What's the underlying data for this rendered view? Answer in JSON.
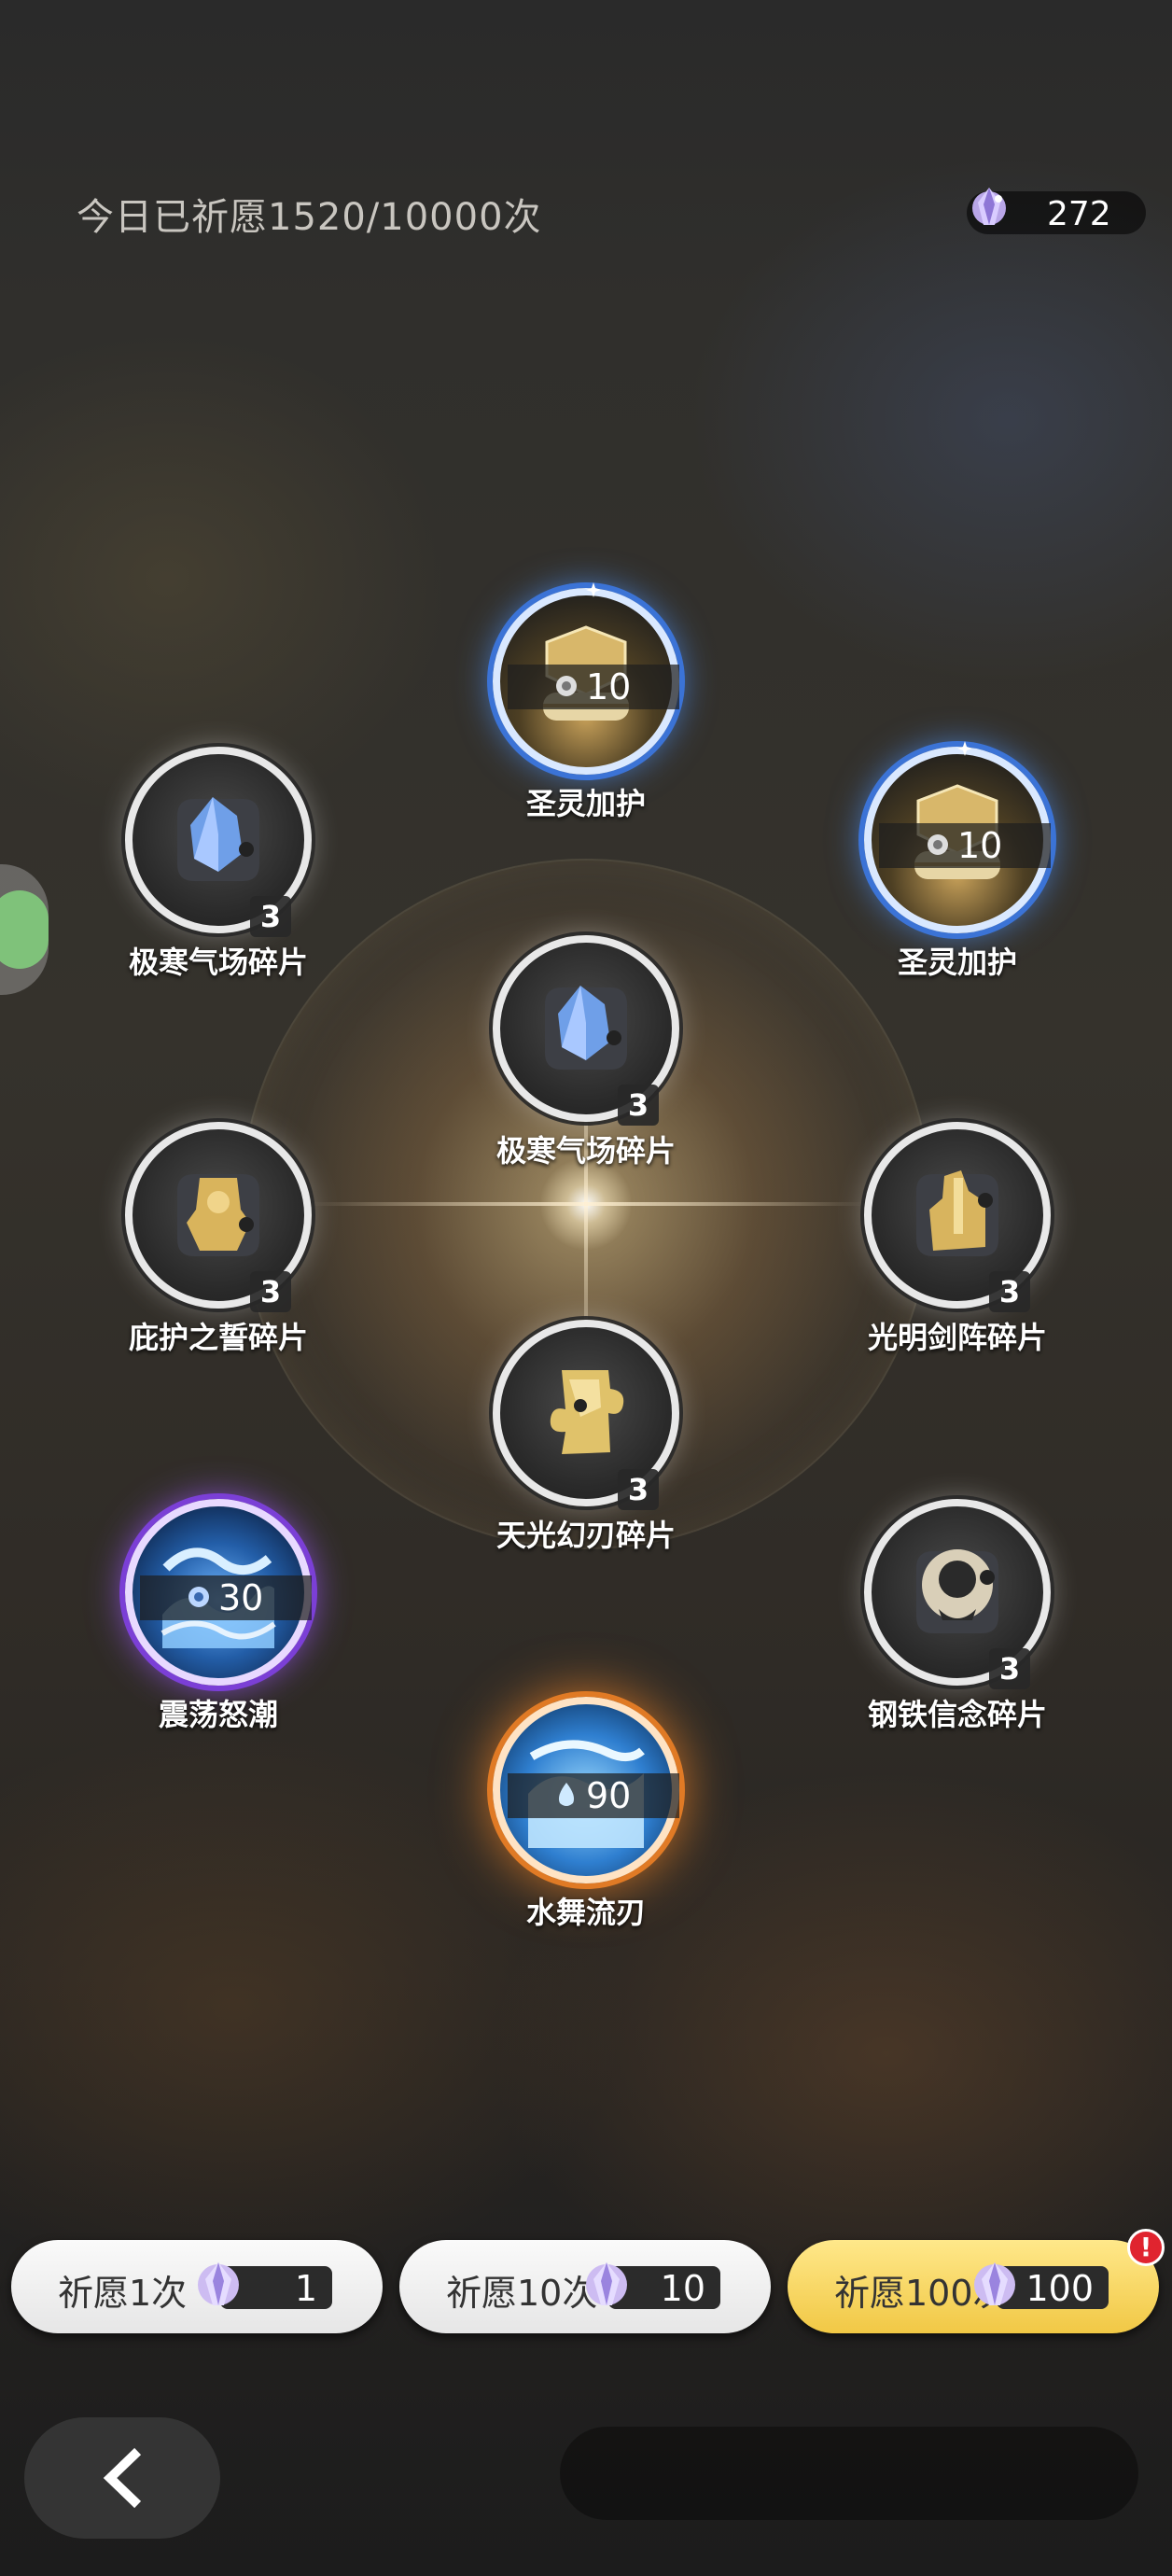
{
  "header": {
    "title": "今日已祈愿1520/10000次",
    "currency_icon": "crystal-gem-icon",
    "currency_count": "272"
  },
  "items": [
    {
      "name": "圣灵加护",
      "rarity": "blue",
      "count": "10",
      "icon": "holy-badge-icon"
    },
    {
      "name": "极寒气场碎片",
      "rarity": "white",
      "count": "3",
      "icon": "ice-crystal-fragment-icon"
    },
    {
      "name": "圣灵加护",
      "rarity": "blue",
      "count": "10",
      "icon": "holy-badge-icon"
    },
    {
      "name": "极寒气场碎片",
      "rarity": "white",
      "count": "3",
      "icon": "ice-crystal-fragment-icon"
    },
    {
      "name": "庇护之誓碎片",
      "rarity": "white",
      "count": "3",
      "icon": "gold-shield-fragment-icon"
    },
    {
      "name": "光明剑阵碎片",
      "rarity": "white",
      "count": "3",
      "icon": "gold-sword-fragment-icon"
    },
    {
      "name": "天光幻刃碎片",
      "rarity": "white",
      "count": "3",
      "icon": "gold-puzzle-fragment-icon"
    },
    {
      "name": "震荡怒潮",
      "rarity": "purple",
      "count": "30",
      "icon": "wave-icon"
    },
    {
      "name": "钢铁信念碎片",
      "rarity": "white",
      "count": "3",
      "icon": "iron-face-fragment-icon"
    },
    {
      "name": "水舞流刃",
      "rarity": "orange",
      "count": "90",
      "icon": "water-blade-icon"
    }
  ],
  "buttons": [
    {
      "label": "祈愿1次",
      "cost": "1"
    },
    {
      "label": "祈愿10次",
      "cost": "10"
    },
    {
      "label": "祈愿100次",
      "cost": "100",
      "alert": "!"
    }
  ],
  "colors": {
    "blue_glow": "#3b73d6",
    "purple_glow": "#7b3fd6",
    "orange_glow": "#e07a25",
    "gold_button": "#f1c845",
    "alert_red": "#e0242f"
  }
}
